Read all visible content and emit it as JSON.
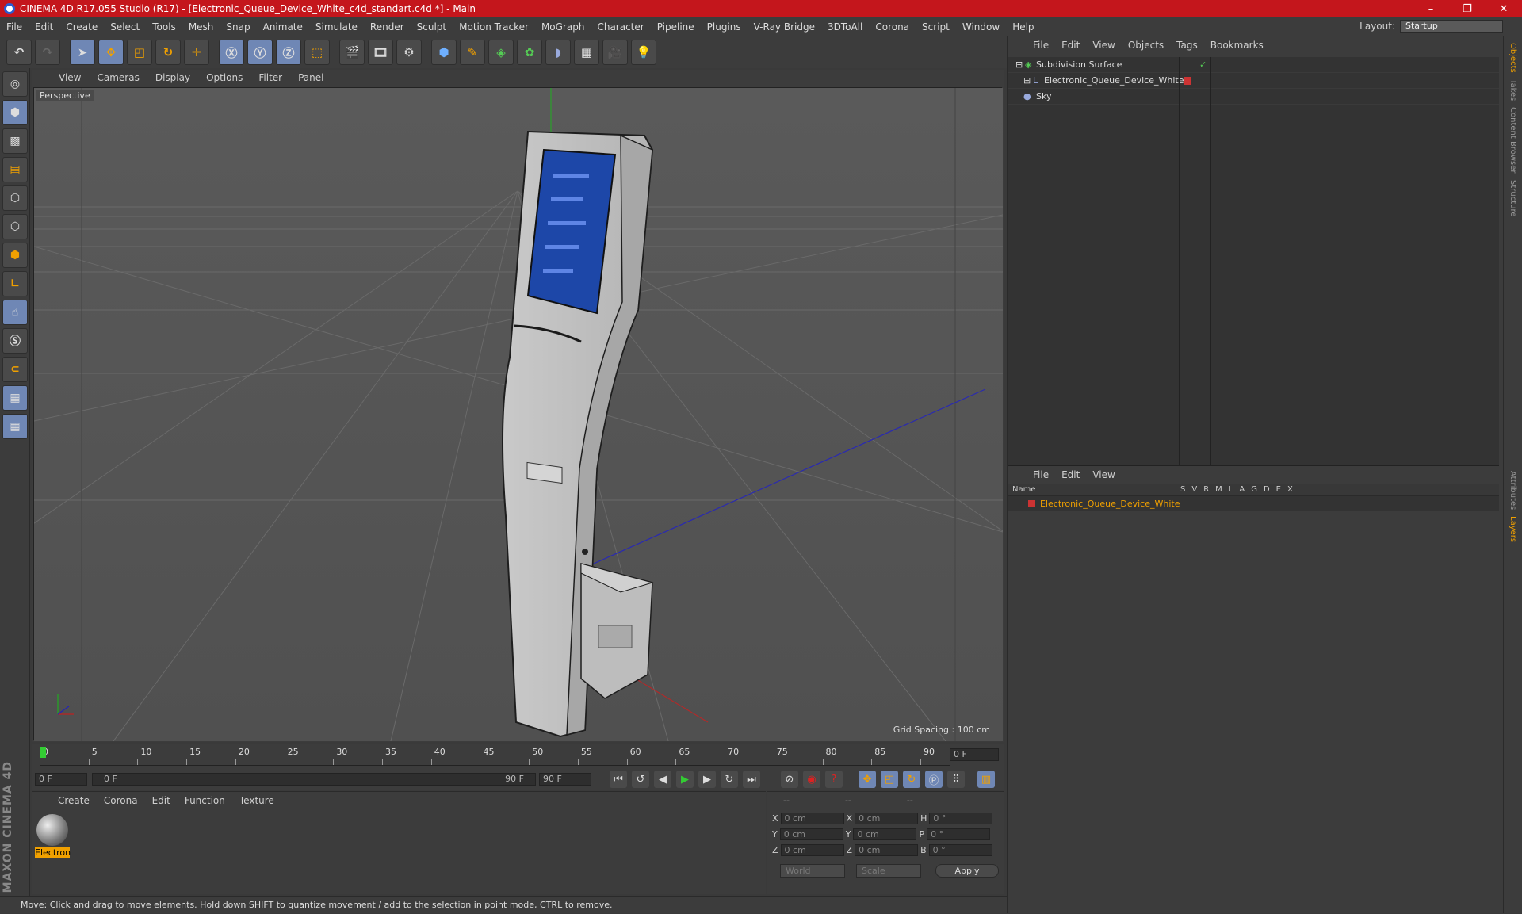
{
  "window": {
    "title": "CINEMA 4D R17.055 Studio (R17) - [Electronic_Queue_Device_White_c4d_standart.c4d *] - Main",
    "minimize": "–",
    "maximize": "❐",
    "close": "✕"
  },
  "menu": [
    "File",
    "Edit",
    "Create",
    "Select",
    "Tools",
    "Mesh",
    "Snap",
    "Animate",
    "Simulate",
    "Render",
    "Sculpt",
    "Motion Tracker",
    "MoGraph",
    "Character",
    "Pipeline",
    "Plugins",
    "V-Ray Bridge",
    "3DToAll",
    "Corona",
    "Script",
    "Window",
    "Help"
  ],
  "layout": {
    "label": "Layout:",
    "value": "Startup"
  },
  "viewport": {
    "menu": [
      "View",
      "Cameras",
      "Display",
      "Options",
      "Filter",
      "Panel"
    ],
    "label": "Perspective",
    "grid_spacing": "Grid Spacing : 100 cm"
  },
  "timeline": {
    "ticks": [
      "0",
      "5",
      "10",
      "15",
      "20",
      "25",
      "30",
      "35",
      "40",
      "45",
      "50",
      "55",
      "60",
      "65",
      "70",
      "75",
      "80",
      "85",
      "90"
    ],
    "current": "0 F",
    "start": "0 F",
    "range_start": "0 F",
    "range_end": "90 F",
    "end": "90 F"
  },
  "materials": {
    "menu": [
      "Create",
      "Corona",
      "Edit",
      "Function",
      "Texture"
    ],
    "item": "Electron"
  },
  "coords": {
    "header1": "--",
    "header2": "--",
    "header3": "--",
    "x": "0 cm",
    "y": "0 cm",
    "z": "0 cm",
    "x2": "0 cm",
    "y2": "0 cm",
    "z2": "0 cm",
    "h": "0 °",
    "p": "0 °",
    "b": "0 °",
    "mode1": "World",
    "mode2": "Scale",
    "apply": "Apply",
    "lx": "X",
    "ly": "Y",
    "lz": "Z",
    "lx2": "X",
    "ly2": "Y",
    "lz2": "Z",
    "lh": "H",
    "lp": "P",
    "lb": "B"
  },
  "status": "Move: Click and drag to move elements. Hold down SHIFT to quantize movement / add to the selection in point mode, CTRL to remove.",
  "objects": {
    "menu": [
      "File",
      "Edit",
      "View",
      "Objects",
      "Tags",
      "Bookmarks"
    ],
    "items": [
      "Subdivision Surface",
      "Electronic_Queue_Device_White",
      "Sky"
    ]
  },
  "layers": {
    "menu": [
      "File",
      "Edit",
      "View"
    ],
    "header_name": "Name",
    "cols": [
      "S",
      "V",
      "R",
      "M",
      "L",
      "A",
      "G",
      "D",
      "E",
      "X"
    ],
    "item": "Electronic_Queue_Device_White"
  },
  "sidetabs": [
    "Objects",
    "Takes",
    "Content Browser",
    "Structure"
  ],
  "sidetabs2": [
    "Attributes",
    "Layers"
  ],
  "maxon": "MAXON CINEMA 4D"
}
